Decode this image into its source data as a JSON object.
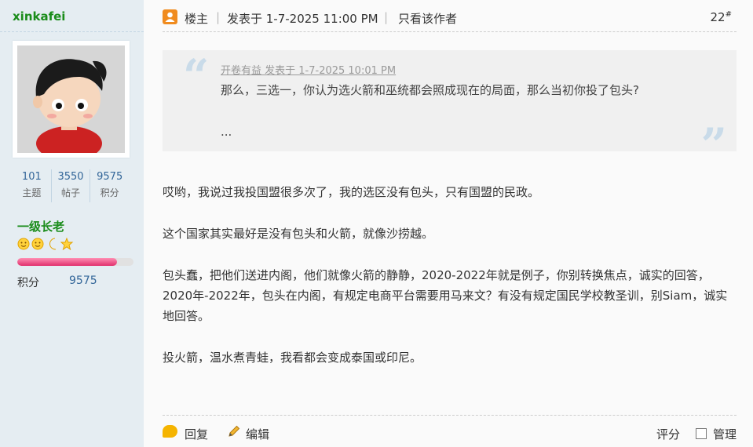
{
  "user": {
    "name": "xinkafei",
    "stats": [
      {
        "value": "101",
        "label": "主题"
      },
      {
        "value": "3550",
        "label": "帖子"
      },
      {
        "value": "9575",
        "label": "积分"
      }
    ],
    "rank": "一级长老",
    "rank_icons": [
      "sun-icon",
      "sun-icon",
      "moon-icon",
      "star-icon"
    ],
    "progress": 0.86,
    "points_label": "积分",
    "points_value": "9575"
  },
  "header": {
    "host_label": "楼主",
    "posted": "发表于 1-7-2025 11:00 PM",
    "only_author": "只看该作者",
    "floor": "22",
    "floor_mark": "#"
  },
  "quote": {
    "meta": "开卷有益 发表于 1-7-2025 10:01 PM",
    "text": "那么，三选一，你认为选火箭和巫统都会照成现在的局面，那么当初你投了包头?",
    "ellipsis": "..."
  },
  "body": [
    "哎哟，我说过我投国盟很多次了，我的选区没有包头，只有国盟的民政。",
    "这个国家其实最好是没有包头和火箭，就像沙捞越。",
    "包头蠢，把他们送进内阁，他们就像火箭的静静，2020-2022年就是例子，你别转换焦点，诚实的回答，2020年-2022年，包头在内阁，有规定电商平台需要用马来文？有没有规定国民学校教圣训，别Siam，诚实地回答。",
    "投火箭，温水煮青蛙，我看都会变成泰国或印尼。"
  ],
  "footer": {
    "reply": "回复",
    "edit": "编辑",
    "rate": "评分",
    "manage": "管理"
  },
  "colors": {
    "sidebar_bg": "#e5edf2",
    "username": "#1a8c1a",
    "link": "#336699",
    "progress": "#e0306c"
  }
}
